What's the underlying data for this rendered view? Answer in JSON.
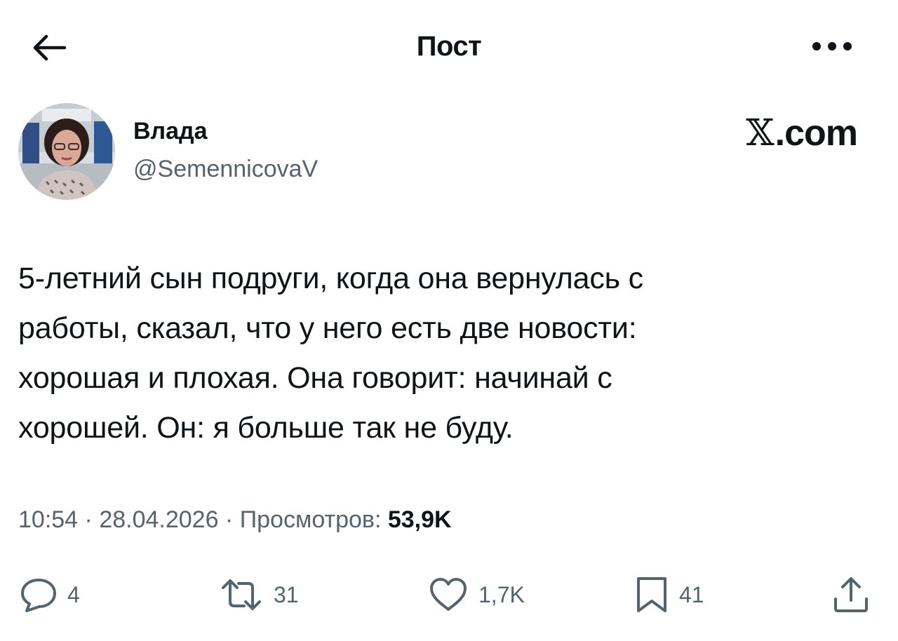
{
  "header": {
    "title": "Пост",
    "back_icon": "arrow-left-icon",
    "more_icon": "more-horizontal-icon"
  },
  "author": {
    "name": "Влада",
    "handle": "@SemennicovaV",
    "avatar": "avatar-photo"
  },
  "brand": {
    "x_glyph": "𝕏",
    "suffix": ".com"
  },
  "tweet": {
    "lines": [
      "5-летний сын подруги, когда она вернулась с",
      "работы, сказал, что у него есть две новости:",
      "хорошая и плохая. Она говорит: начинай с",
      "хорошей. Он: я больше так не буду."
    ]
  },
  "meta": {
    "time": "10:54",
    "sep1": " · ",
    "date": "28.04.2026",
    "sep2": " · ",
    "views_label": "Просмотров: ",
    "views_count": "53,9K"
  },
  "actions": {
    "reply": {
      "icon": "reply-icon",
      "count": "4"
    },
    "repost": {
      "icon": "repost-icon",
      "count": "31"
    },
    "like": {
      "icon": "heart-icon",
      "count": "1,7K"
    },
    "bookmark": {
      "icon": "bookmark-icon",
      "count": "41"
    },
    "share": {
      "icon": "share-icon"
    }
  },
  "colors": {
    "text": "#0f1419",
    "secondary": "#536471",
    "background": "#ffffff"
  }
}
